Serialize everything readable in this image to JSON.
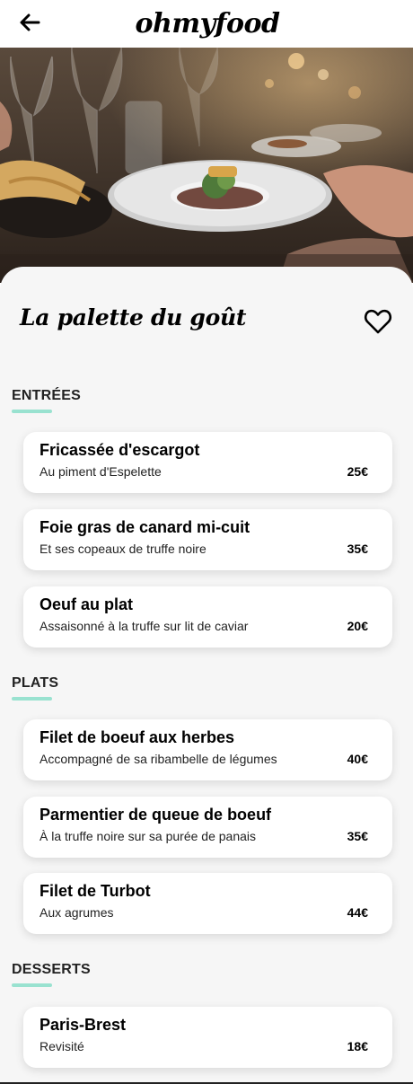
{
  "header": {
    "logo": "ohmyfood",
    "back_icon": "arrow-left-icon"
  },
  "hero": {
    "image_alt": "restaurant-table-photo"
  },
  "restaurant": {
    "name": "La palette du goût",
    "favorite_icon": "heart-outline-icon"
  },
  "sections": [
    {
      "title": "ENTRÉES",
      "items": [
        {
          "name": "Fricassée d'escargot",
          "description": "Au piment d'Espelette",
          "price": "25€"
        },
        {
          "name": "Foie gras de canard mi-cuit",
          "description": "Et ses copeaux de truffe noire",
          "price": "35€"
        },
        {
          "name": "Oeuf au plat",
          "description": "Assaisonné à la truffe sur lit de caviar",
          "price": "20€"
        }
      ]
    },
    {
      "title": "PLATS",
      "items": [
        {
          "name": "Filet de boeuf aux herbes",
          "description": "Accompagné de sa ribambelle de légumes",
          "price": "40€"
        },
        {
          "name": "Parmentier de queue de boeuf",
          "description": "À la truffe noire sur sa purée de panais",
          "price": "35€"
        },
        {
          "name": "Filet de Turbot",
          "description": "Aux agrumes",
          "price": "44€"
        }
      ]
    },
    {
      "title": "DESSERTS",
      "items": [
        {
          "name": "Paris-Brest",
          "description": "Revisité",
          "price": "18€"
        }
      ]
    }
  ],
  "colors": {
    "accent": "#99e2d0",
    "background": "#f6f6f6",
    "card": "#ffffff"
  }
}
